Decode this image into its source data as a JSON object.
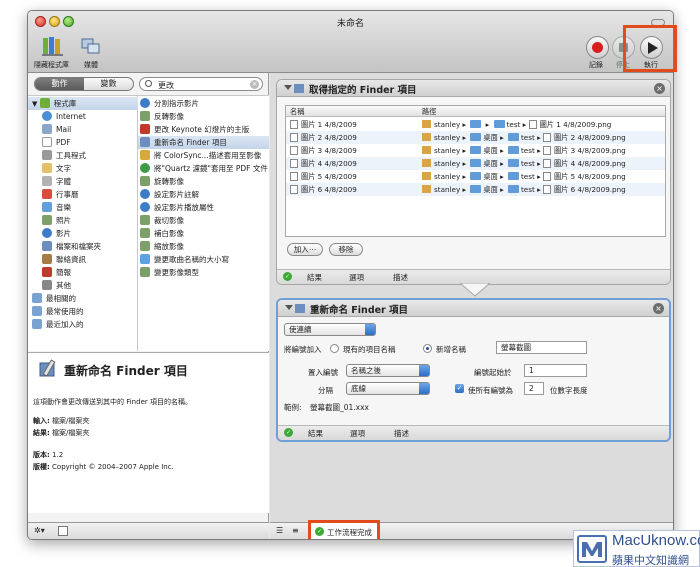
{
  "window": {
    "title": "未命名"
  },
  "toolbar": {
    "library_label": "隱藏程式庫",
    "media_label": "媒體",
    "record_label": "記錄",
    "stop_label": "停止",
    "run_label": "執行"
  },
  "library": {
    "tabs": [
      {
        "label": "動作",
        "active": true
      },
      {
        "label": "變數",
        "active": false
      }
    ],
    "search_value": "更改",
    "categories": [
      {
        "label": "程式庫",
        "icon": "library-icon"
      },
      {
        "label": "Internet",
        "icon": "globe-icon"
      },
      {
        "label": "Mail",
        "icon": "mail-icon"
      },
      {
        "label": "PDF",
        "icon": "pdf-icon"
      },
      {
        "label": "工具程式",
        "icon": "tools-icon"
      },
      {
        "label": "文字",
        "icon": "text-icon"
      },
      {
        "label": "字體",
        "icon": "font-icon"
      },
      {
        "label": "行事曆",
        "icon": "calendar-icon"
      },
      {
        "label": "音樂",
        "icon": "music-icon"
      },
      {
        "label": "照片",
        "icon": "photo-icon"
      },
      {
        "label": "影片",
        "icon": "movie-icon"
      },
      {
        "label": "檔案和檔案夾",
        "icon": "finder-icon"
      },
      {
        "label": "聯絡資訊",
        "icon": "contacts-icon"
      },
      {
        "label": "簡報",
        "icon": "presentation-icon"
      },
      {
        "label": "其他",
        "icon": "other-icon"
      },
      {
        "label": "最相關的",
        "icon": "folder-icon"
      },
      {
        "label": "最常使用的",
        "icon": "folder-icon"
      },
      {
        "label": "最近加入的",
        "icon": "folder-icon"
      }
    ],
    "actions": [
      {
        "label": "分割指示影片",
        "selected": false
      },
      {
        "label": "反轉影像",
        "selected": false
      },
      {
        "label": "更改 Keynote 幻燈片的主版",
        "selected": false
      },
      {
        "label": "重新命名 Finder 項目",
        "selected": true
      },
      {
        "label": "將 ColorSync...描述套用至影像",
        "selected": false
      },
      {
        "label": "將\"Quartz 濾鏡\"套用至 PDF 文件",
        "selected": false
      },
      {
        "label": "旋轉影像",
        "selected": false
      },
      {
        "label": "設定影片註解",
        "selected": false
      },
      {
        "label": "設定影片播放屬性",
        "selected": false
      },
      {
        "label": "裁切影像",
        "selected": false
      },
      {
        "label": "補白影像",
        "selected": false
      },
      {
        "label": "縮放影像",
        "selected": false
      },
      {
        "label": "變更歌曲名稱的大小寫",
        "selected": false
      },
      {
        "label": "變更影像類型",
        "selected": false
      }
    ]
  },
  "description": {
    "title": "重新命名 Finder 項目",
    "summary": "這項動作會更改傳送到其中的 Finder 項目的名稱。",
    "input_label": "輸入:",
    "input_value": "檔案/檔案夾",
    "result_label": "結果:",
    "result_value": "檔案/檔案夾",
    "version_label": "版本:",
    "version_value": "1.2",
    "copyright_label": "版權:",
    "copyright_value": "Copyright © 2004–2007 Apple Inc."
  },
  "action1": {
    "title": "取得指定的 Finder 項目",
    "col_name": "名稱",
    "col_path": "路徑",
    "rows": [
      {
        "name": "圖片 1 4/8/2009",
        "user": "stanley",
        "folder": "",
        "sub": "test",
        "file": "圖片 1 4/8/2009.png"
      },
      {
        "name": "圖片 2 4/8/2009",
        "user": "stanley",
        "folder": "桌面",
        "sub": "test",
        "file": "圖片 2 4/8/2009.png"
      },
      {
        "name": "圖片 3 4/8/2009",
        "user": "stanley",
        "folder": "桌面",
        "sub": "test",
        "file": "圖片 3 4/8/2009.png"
      },
      {
        "name": "圖片 4 4/8/2009",
        "user": "stanley",
        "folder": "桌面",
        "sub": "test",
        "file": "圖片 4 4/8/2009.png"
      },
      {
        "name": "圖片 5 4/8/2009",
        "user": "stanley",
        "folder": "桌面",
        "sub": "test",
        "file": "圖片 5 4/8/2009.png"
      },
      {
        "name": "圖片 6 4/8/2009",
        "user": "stanley",
        "folder": "桌面",
        "sub": "test",
        "file": "圖片 6 4/8/2009.png"
      }
    ],
    "add_label": "加入⋯",
    "remove_label": "移除",
    "footer": {
      "results": "結果",
      "options": "選項",
      "description": "描述"
    }
  },
  "action2": {
    "title": "重新命名 Finder 項目",
    "mode": "使連續",
    "add_number_label": "將編號加入",
    "existing_name_label": "現有的項目名稱",
    "new_name_label": "新增名稱",
    "new_name_value": "螢幕截圖",
    "place_label": "置入編號",
    "place_value": "名稱之後",
    "start_label": "編號起始於",
    "start_value": "1",
    "separator_label": "分隔",
    "separator_value": "底線",
    "all_same_length_label": "使所有編號為",
    "digits_value": "2",
    "digits_suffix": "位數字長度",
    "example_label": "範例:",
    "example_value": "螢幕截圖_01.xxx",
    "footer": {
      "results": "結果",
      "options": "選項",
      "description": "描述"
    }
  },
  "status": {
    "text": "工作流程完成"
  },
  "watermark": {
    "line1": "MacUknow.com",
    "line2": "蘋果中文知識網"
  },
  "colors": {
    "highlight": "#e34a1c",
    "accent": "#2d6fc5",
    "ok": "#3aa935"
  }
}
